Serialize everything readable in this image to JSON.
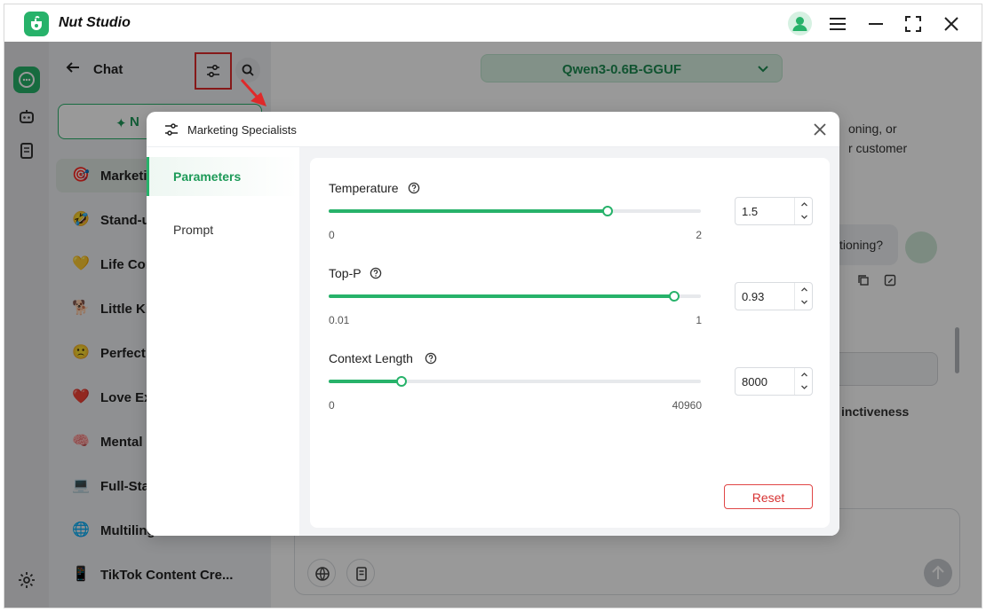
{
  "app": {
    "title": "Nut Studio",
    "accent": "#27b26a"
  },
  "sidebar": {
    "title": "Chat",
    "new_chat_label": "N",
    "items": [
      {
        "emoji": "🎯",
        "label": "Marketi"
      },
      {
        "emoji": "🤣",
        "label": "Stand-u"
      },
      {
        "emoji": "💛",
        "label": "Life Cor"
      },
      {
        "emoji": "🐕",
        "label": "Little Ki"
      },
      {
        "emoji": "🙁",
        "label": "Perfect"
      },
      {
        "emoji": "❤️",
        "label": "Love Ex"
      },
      {
        "emoji": "🧠",
        "label": "Mental"
      },
      {
        "emoji": "💻",
        "label": "Full-Sta"
      },
      {
        "emoji": "🌐",
        "label": "Multiling"
      },
      {
        "emoji": "📱",
        "label": "TikTok Content Cre..."
      }
    ]
  },
  "main": {
    "model": "Qwen3-0.6B-GGUF",
    "fragments": [
      "oning, or",
      "r customer",
      "tioning?",
      "inctiveness",
      "."
    ]
  },
  "modal": {
    "title": "Marketing Specialists",
    "nav": [
      {
        "label": "Parameters",
        "active": true
      },
      {
        "label": "Prompt",
        "active": false
      }
    ],
    "params": [
      {
        "label": "Temperature",
        "min": "0",
        "max": "2",
        "value": "1.5",
        "fraction": 0.75
      },
      {
        "label": "Top-P",
        "min": "0.01",
        "max": "1",
        "value": "0.93",
        "fraction": 0.929
      },
      {
        "label": "Context Length",
        "min": "0",
        "max": "40960",
        "value": "8000",
        "fraction": 0.195
      }
    ],
    "reset_label": "Reset"
  }
}
